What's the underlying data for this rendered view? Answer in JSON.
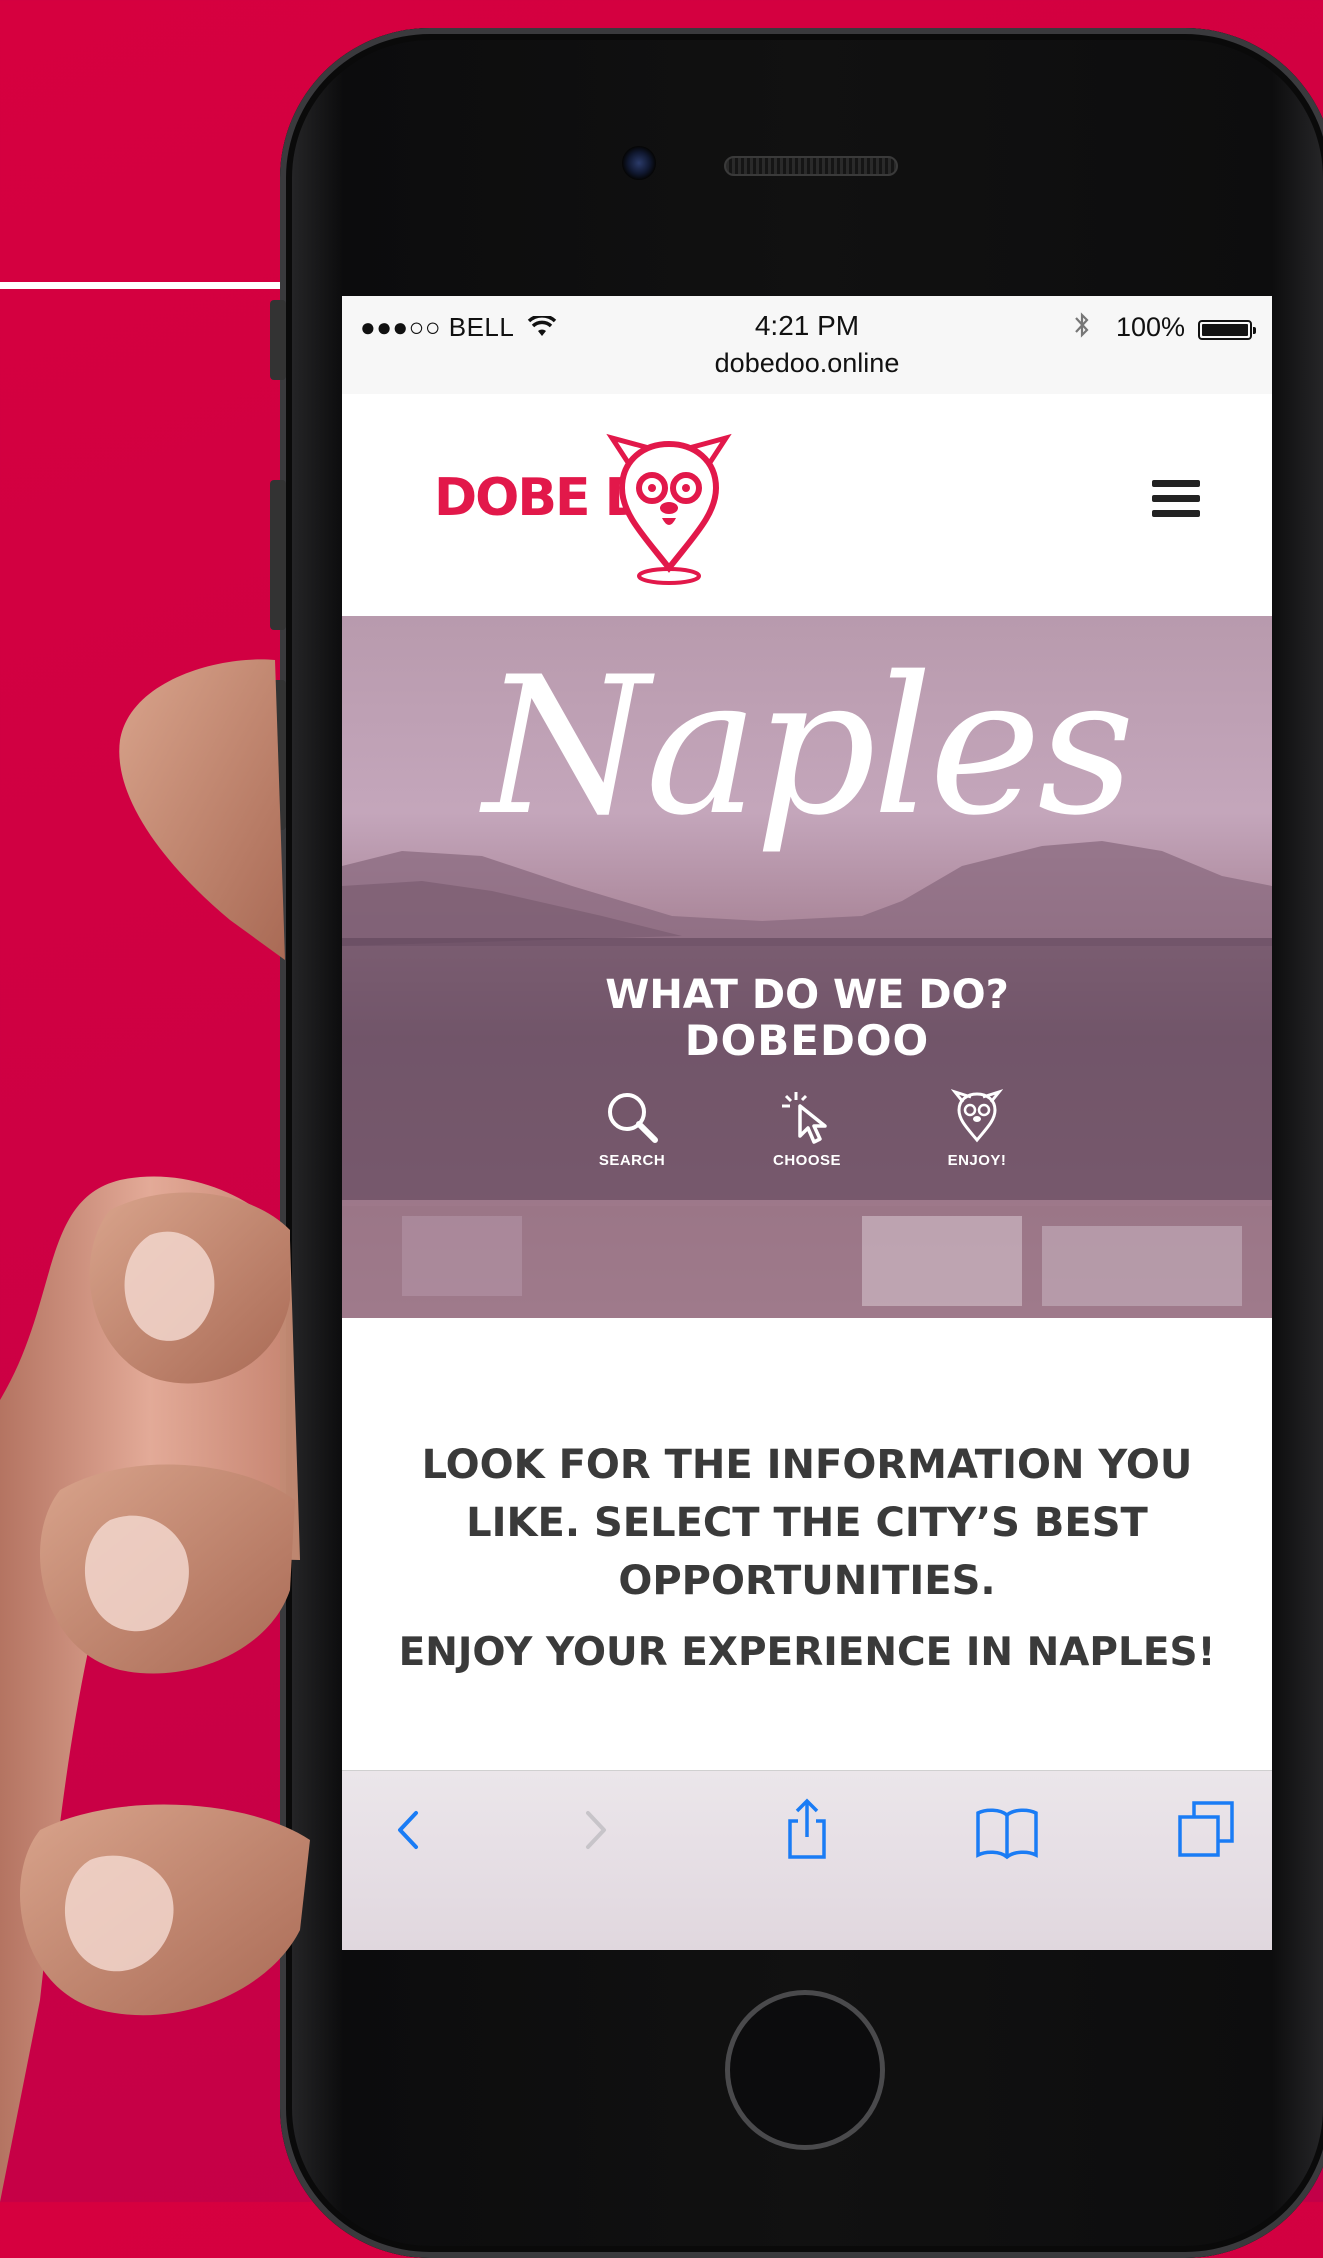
{
  "statusbar": {
    "carrier": "●●●○○ BELL",
    "wifi_icon": "wifi-icon",
    "time": "4:21 PM",
    "url": "dobedoo.online",
    "bluetooth_icon": "bluetooth-icon",
    "battery": "100%"
  },
  "header": {
    "logo_text": "DOBE D",
    "menu_icon": "hamburger-menu-icon"
  },
  "hero": {
    "title": "Naples",
    "band_line1": "WHAT DO WE DO?",
    "band_line2": "DOBEDOO",
    "steps": [
      {
        "label": "SEARCH",
        "icon": "search-icon"
      },
      {
        "label": "CHOOSE",
        "icon": "cursor-click-icon"
      },
      {
        "label": "ENJOY!",
        "icon": "dog-pin-icon"
      }
    ]
  },
  "content": {
    "paragraph": "LOOK FOR THE INFORMATION YOU LIKE. SELECT THE CITY’S BEST OPPORTUNITIES.",
    "tagline": "ENJOY YOUR EXPERIENCE IN NAPLES!"
  },
  "toolbar": {
    "buttons": [
      "back-icon",
      "forward-icon",
      "share-icon",
      "bookmarks-icon",
      "tabs-icon"
    ]
  },
  "colors": {
    "background": "#d6003f",
    "brand": "#e2184a",
    "ios_blue": "#1a7cf5",
    "text_dark": "#3a3a3a"
  }
}
